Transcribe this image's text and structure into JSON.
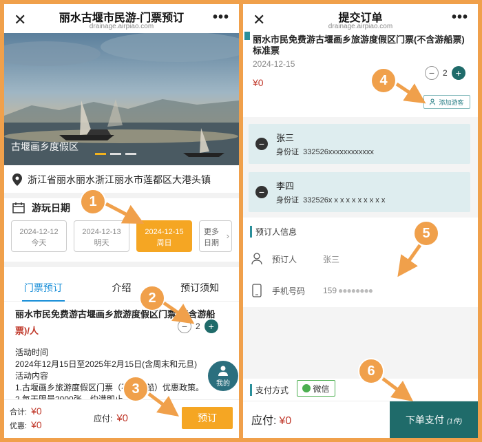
{
  "left": {
    "title": "丽水古堰市民游-门票预订",
    "url": "drainage.airpiao.com",
    "hero_caption": "古堰画乡度假区",
    "address": "浙江省丽水丽水浙江丽水市莲都区大港头镇",
    "date_label": "游玩日期",
    "dates": [
      {
        "date": "2024-12-12",
        "day": "今天"
      },
      {
        "date": "2024-12-13",
        "day": "明天"
      },
      {
        "date": "2024-12-15",
        "day": "周日"
      }
    ],
    "more_l1": "更多",
    "more_l2": "日期",
    "tabs": [
      "门票预订",
      "介绍",
      "预订须知"
    ],
    "product_name": "丽水市民免费游古堰画乡旅游度假区门票(不含游船",
    "product_price": "票)/人",
    "qty": "2",
    "activity": [
      "活动时间",
      "2024年12月15日至2025年2月15日(含周末和元旦)",
      "活动内容",
      "1.古堰画乡旅游度假区门票（不含游船）优惠政策。",
      "2.每天限量2000张，约满即止"
    ],
    "mine": "我的",
    "total_label": "合计:",
    "total_value": "¥0",
    "discount_label": "优惠:",
    "discount_value": "¥0",
    "pay_label": "应付:",
    "pay_value": "¥0",
    "book_button": "预订"
  },
  "right": {
    "title": "提交订单",
    "url": "drainage.airpiao.com",
    "product_name": "丽水市民免费游古堰画乡旅游度假区门票(不含游船票)标准票",
    "date": "2024-12-15",
    "price": "¥0",
    "qty": "2",
    "add_visitor": "添加游客",
    "visitors": [
      {
        "name": "张三",
        "id_label": "身份证",
        "id_value": "332526xxxxxxxxxxxx"
      },
      {
        "name": "李四",
        "id_label": "身份证",
        "id_value": "332526x x x x x x x x x x"
      }
    ],
    "booker_section": "预订人信息",
    "booker_label": "预订人",
    "booker_value": "张三",
    "phone_label": "手机号码",
    "phone_value": "159",
    "pay_method": "支付方式",
    "wechat": "微信",
    "pay_label": "应付:",
    "pay_value": "¥0",
    "submit": "下单支付",
    "submit_count": "(1件)"
  },
  "badges": [
    "1",
    "2",
    "3",
    "4",
    "5",
    "6"
  ],
  "colors": {
    "accent_orange": "#f5a623",
    "teal": "#1f6b6a",
    "tab_blue": "#1a8fd8",
    "price_red": "#c0392b"
  }
}
